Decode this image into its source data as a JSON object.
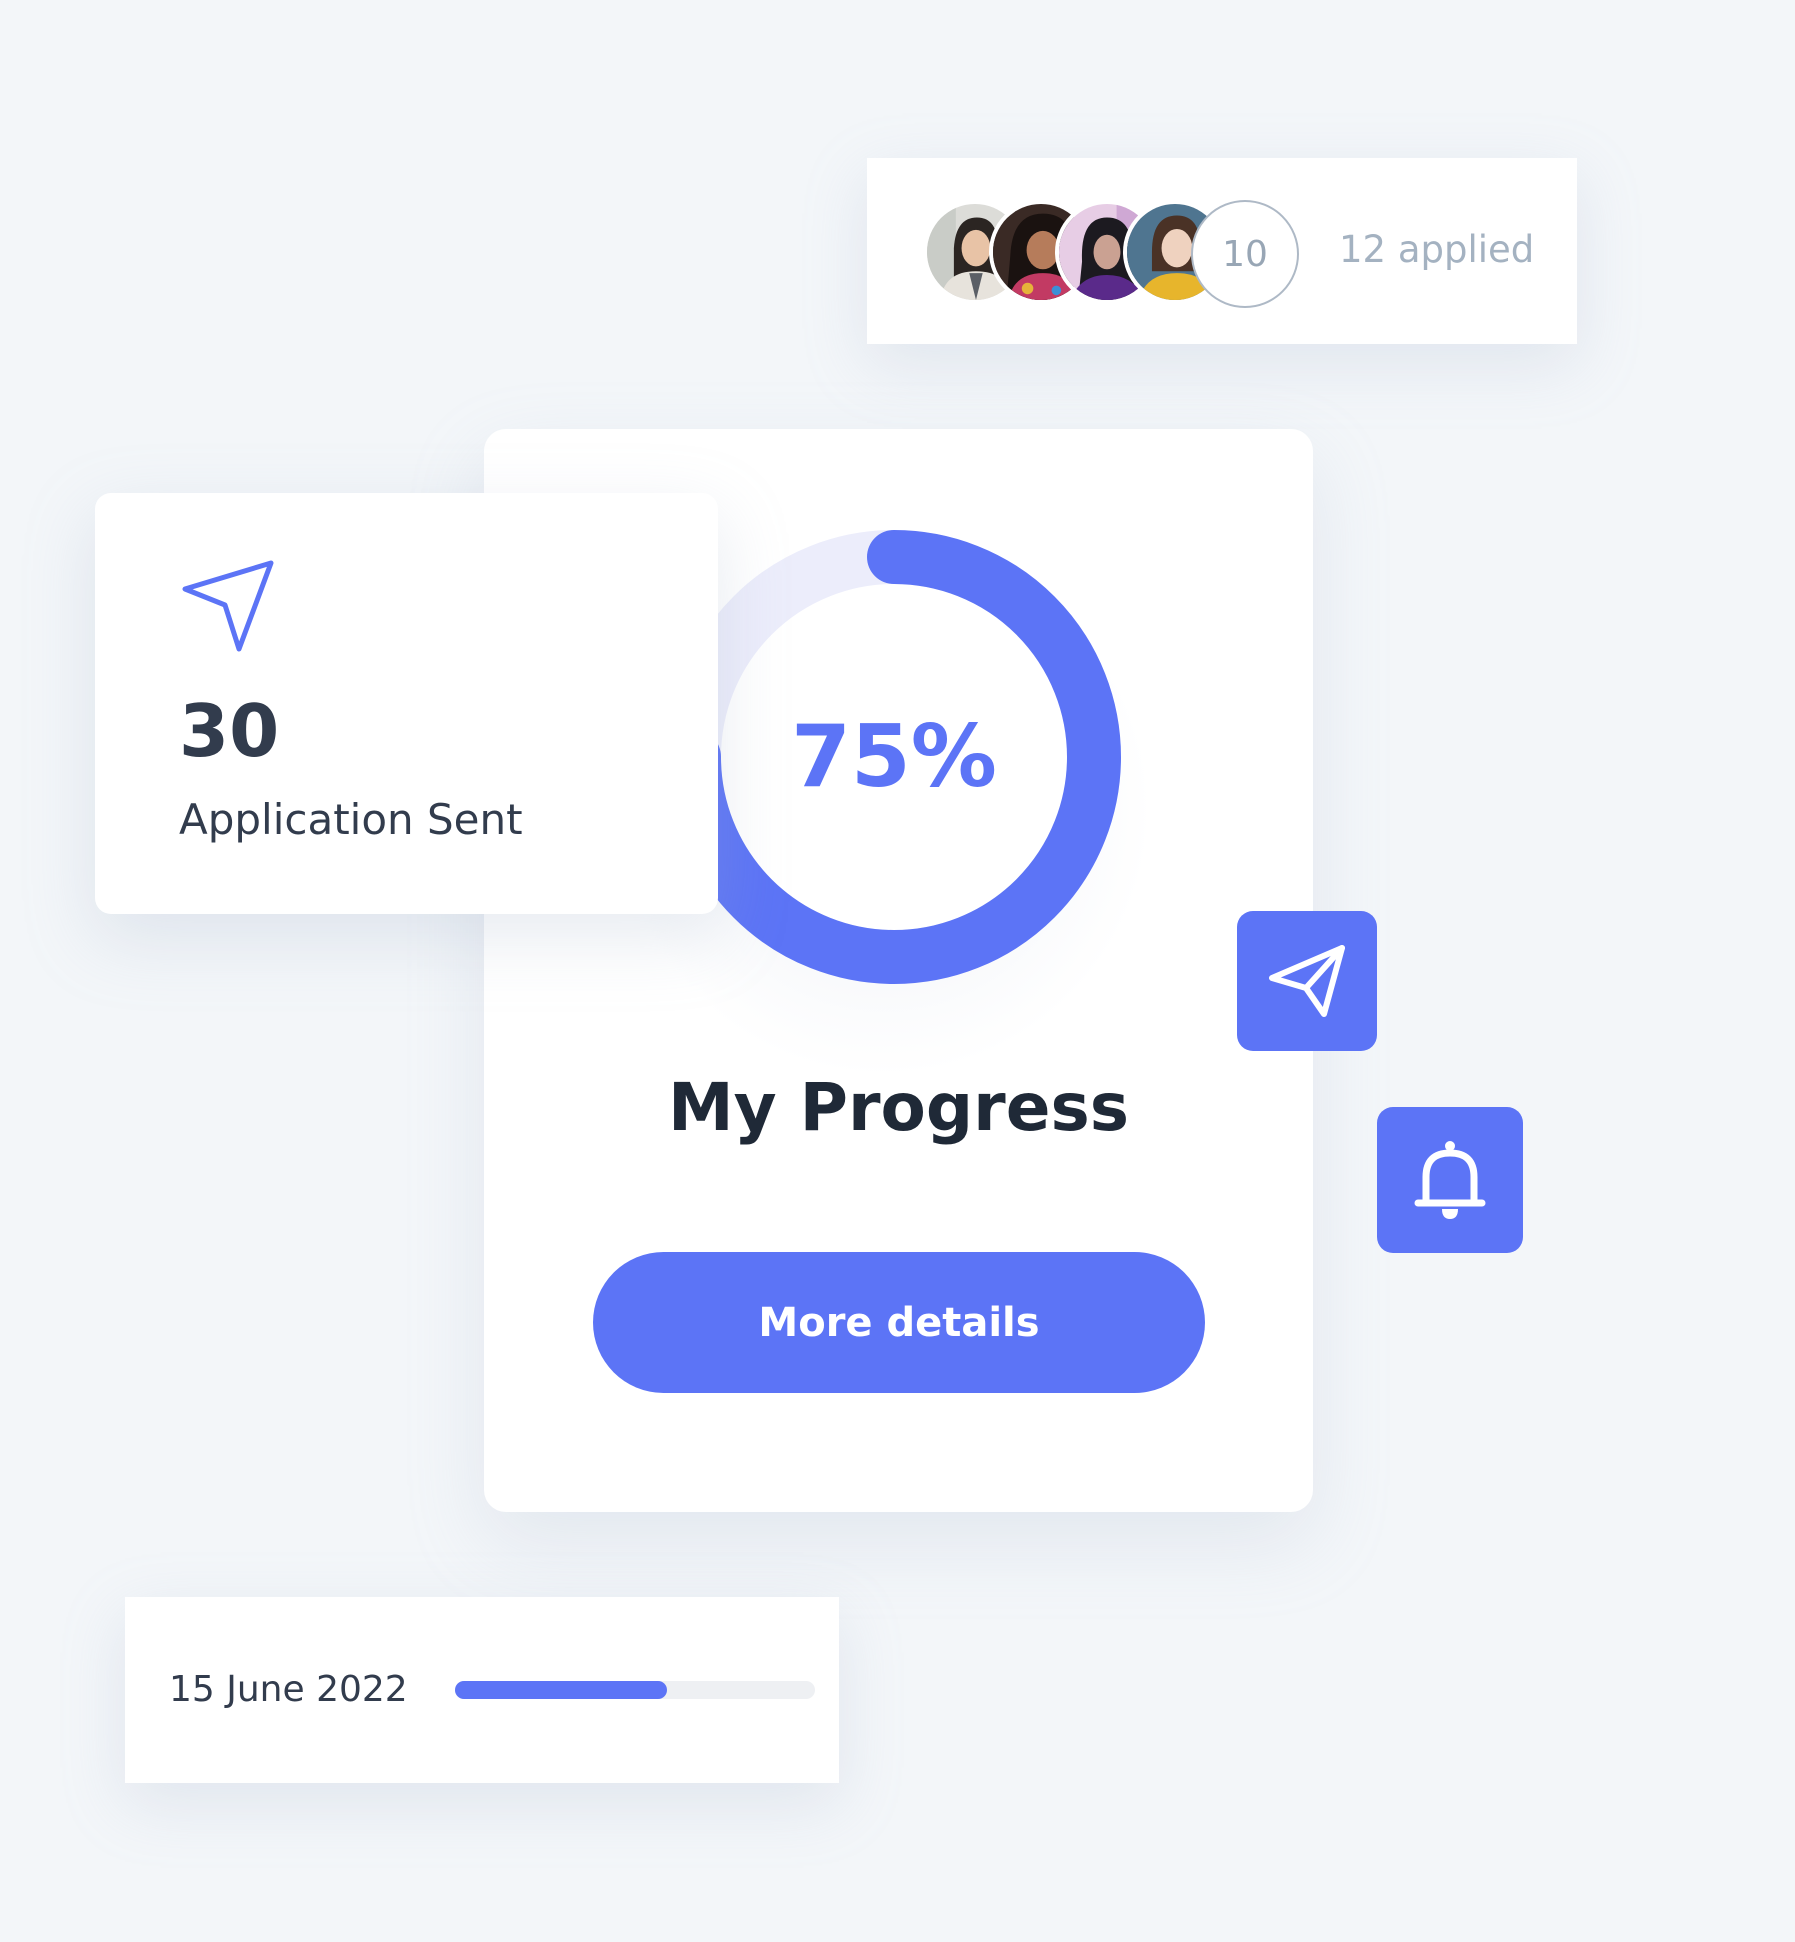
{
  "applicants": {
    "avatar_count": "10",
    "applied_label": "12 applied"
  },
  "application_sent": {
    "count": "30",
    "label": "Application Sent"
  },
  "progress": {
    "percent_label": "75%",
    "percent_value": 75,
    "title": "My Progress",
    "button_label": "More details"
  },
  "timeline": {
    "date": "15 June 2022",
    "fill_fraction": 0.59
  },
  "icons": {
    "sent_card": "send-arrow-icon",
    "send_button": "paper-plane-icon",
    "bell_button": "bell-icon"
  },
  "colors": {
    "accent": "#5c74f6",
    "ring_track": "#ecedfb",
    "background": "#f3f6f9",
    "heading": "#1f2937",
    "muted": "#a4b2c1"
  }
}
